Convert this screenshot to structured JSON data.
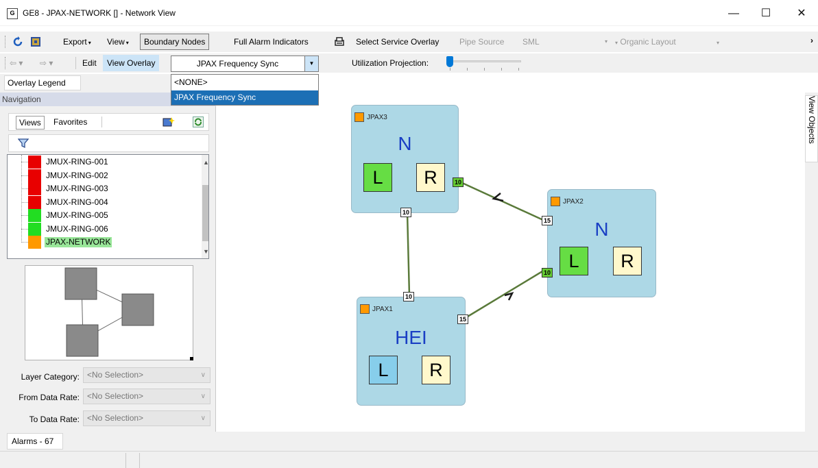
{
  "window": {
    "title": "GE8 - JPAX-NETWORK [] - Network View",
    "app_icon": "network-view-icon",
    "controls": {
      "minimize": "—",
      "maximize": "☐",
      "close": "✕"
    }
  },
  "toolbar1": {
    "refresh_icon": "refresh-icon",
    "map_icon": "map-icon",
    "export_label": "Export",
    "view_label": "View",
    "boundary_nodes_label": "Boundary Nodes",
    "full_alarm_label": "Full Alarm Indicators",
    "select_service_label": "Select Service Overlay",
    "pipe_source_label": "Pipe Source",
    "pipe_source_value": "SML",
    "layout_label": "Organic Layout",
    "overflow": "›"
  },
  "toolbar2": {
    "edit_label": "Edit",
    "view_overlay_label": "View Overlay",
    "overlay_selected": "JPAX Frequency Sync",
    "utilization_label": "Utilization Projection:",
    "utilization_value": 0
  },
  "overlay_options": [
    "<NONE>",
    "JPAX Frequency Sync"
  ],
  "left_panel": {
    "overlay_legend_tab": "Overlay Legend",
    "navigation_header": "Navigation",
    "tabs": [
      "Views",
      "Favorites"
    ],
    "tree_items": [
      {
        "label": "JMUX-RING-001",
        "color": "#e80000"
      },
      {
        "label": "JMUX-RING-002",
        "color": "#e80000"
      },
      {
        "label": "JMUX-RING-003",
        "color": "#e80000"
      },
      {
        "label": "JMUX-RING-004",
        "color": "#e80000"
      },
      {
        "label": "JMUX-RING-005",
        "color": "#22dd22"
      },
      {
        "label": "JMUX-RING-006",
        "color": "#22dd22"
      },
      {
        "label": "JPAX-NETWORK",
        "color": "#ff9900"
      }
    ],
    "filters": [
      {
        "label": "Layer Category:",
        "value": "<No Selection>"
      },
      {
        "label": "From Data Rate:",
        "value": "<No Selection>"
      },
      {
        "label": "To Data Rate:",
        "value": "<No Selection>"
      }
    ]
  },
  "canvas": {
    "view_objects_label": "View Objects",
    "nodes": [
      {
        "id": "jpax3",
        "name": "JPAX3",
        "type": "N",
        "l_color": "#66dd44"
      },
      {
        "id": "jpax2",
        "name": "JPAX2",
        "type": "N",
        "l_color": "#66dd44"
      },
      {
        "id": "jpax1",
        "name": "JPAX1",
        "type": "HEI",
        "l_color": "#87ceeb"
      }
    ],
    "box_labels": {
      "left": "L",
      "right": "R"
    },
    "ports": {
      "jpax3_right": "10",
      "jpax3_bottom": "10",
      "jpax2_left": "15",
      "jpax2_bottom": "10",
      "jpax1_top": "10",
      "jpax1_right": "15"
    },
    "link_color": "#5a7a3a"
  },
  "bottom": {
    "alarms_tab": "Alarms - 67"
  }
}
